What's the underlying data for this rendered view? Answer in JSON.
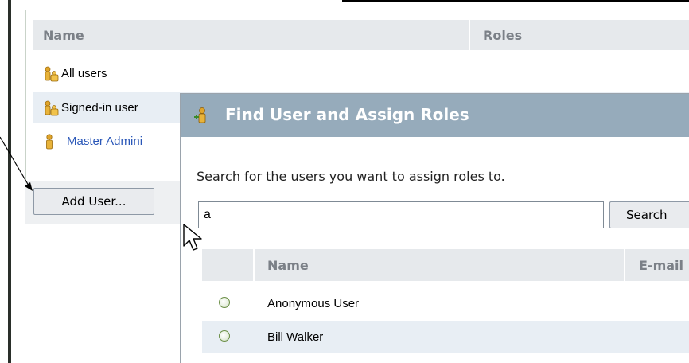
{
  "users_panel": {
    "header": {
      "name": "Name",
      "roles": "Roles"
    },
    "rows": [
      {
        "label": "All users",
        "icon": "group-users-icon"
      },
      {
        "label": "Signed-in user",
        "icon": "group-users-icon"
      },
      {
        "label": "Master Admini",
        "icon": "single-user-icon"
      }
    ],
    "add_user_label": "Add User..."
  },
  "dialog": {
    "title": "Find User and Assign Roles",
    "instructions": "Search for the users you want to assign roles to.",
    "search_value": "a",
    "search_button": "Search",
    "results_header": {
      "name": "Name",
      "email": "E-mail"
    },
    "results": [
      {
        "name": "Anonymous User"
      },
      {
        "name": "Bill Walker"
      }
    ]
  },
  "colors": {
    "title_bar": "#96abbb",
    "header_bg": "#e6e9ec",
    "alt_row": "#e8eef4",
    "link": "#2a57b8"
  }
}
